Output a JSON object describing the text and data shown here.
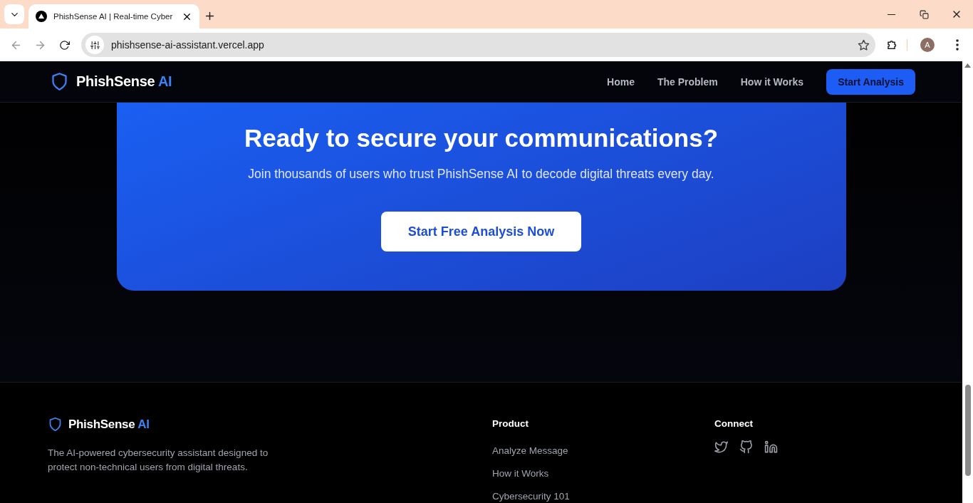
{
  "browser": {
    "tab_title": "PhishSense AI | Real-time Cyber",
    "url": "phishsense-ai-assistant.vercel.app",
    "profile_initial": "A"
  },
  "nav": {
    "brand": {
      "name": "PhishSense",
      "accent": "AI"
    },
    "links": [
      "Home",
      "The Problem",
      "How it Works"
    ],
    "cta": "Start Analysis"
  },
  "cta": {
    "title": "Ready to secure your communications?",
    "subtitle": "Join thousands of users who trust PhishSense AI to decode digital threats every day.",
    "button": "Start Free Analysis Now"
  },
  "footer": {
    "brand": {
      "name": "PhishSense",
      "accent": "AI"
    },
    "description": "The AI-powered cybersecurity assistant designed to protect non-technical users from digital threats.",
    "product": {
      "heading": "Product",
      "links": [
        "Analyze Message",
        "How it Works",
        "Cybersecurity 101"
      ]
    },
    "connect": {
      "heading": "Connect"
    }
  }
}
